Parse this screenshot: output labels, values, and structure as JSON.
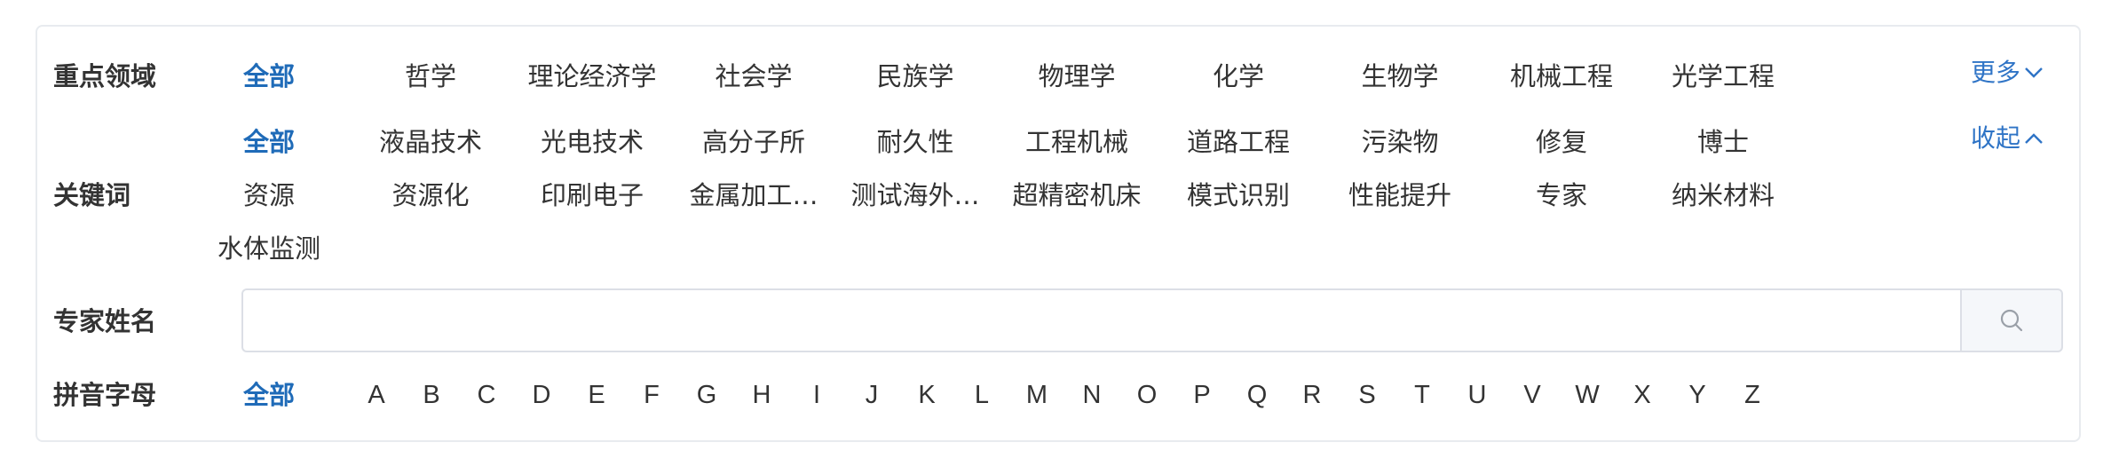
{
  "fields": {
    "label": "重点领域",
    "options": [
      "全部",
      "哲学",
      "理论经济学",
      "社会学",
      "民族学",
      "物理学",
      "化学",
      "生物学",
      "机械工程",
      "光学工程"
    ],
    "more_label": "更多"
  },
  "keywords": {
    "label": "关键词",
    "options": [
      "全部",
      "液晶技术",
      "光电技术",
      "高分子所",
      "耐久性",
      "工程机械",
      "道路工程",
      "污染物",
      "修复",
      "博士",
      "资源",
      "资源化",
      "印刷电子",
      "金属加工…",
      "测试海外…",
      "超精密机床",
      "模式识别",
      "性能提升",
      "专家",
      "纳米材料",
      "水体监测"
    ],
    "collapse_label": "收起"
  },
  "expert_name": {
    "label": "专家姓名",
    "value": "",
    "placeholder": ""
  },
  "pinyin": {
    "label": "拼音字母",
    "all_label": "全部",
    "letters": [
      "A",
      "B",
      "C",
      "D",
      "E",
      "F",
      "G",
      "H",
      "I",
      "J",
      "K",
      "L",
      "M",
      "N",
      "O",
      "P",
      "Q",
      "R",
      "S",
      "T",
      "U",
      "V",
      "W",
      "X",
      "Y",
      "Z"
    ]
  },
  "colors": {
    "accent": "#1f6bb8",
    "link": "#2f74c6",
    "text": "#333333",
    "border": "#e8ebef"
  },
  "icons": {
    "more": "chevron-down-icon",
    "collapse": "chevron-up-icon",
    "search": "search-icon"
  }
}
